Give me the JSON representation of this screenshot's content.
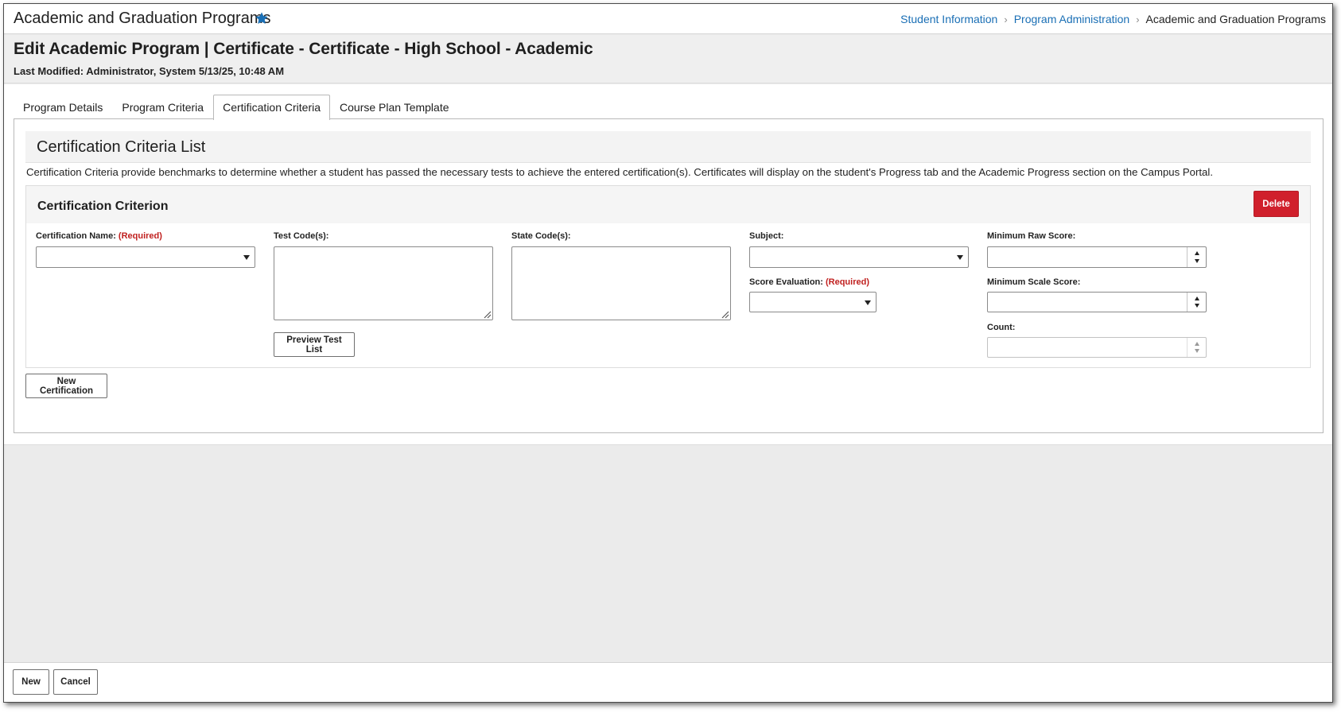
{
  "header": {
    "app_title": "Academic and Graduation Programs",
    "favorite_icon": "star-icon",
    "breadcrumb": {
      "items": [
        "Student Information",
        "Program Administration"
      ],
      "current": "Academic and Graduation Programs"
    }
  },
  "page": {
    "title": "Edit Academic Program | Certificate - Certificate - High School - Academic",
    "last_modified": "Last Modified: Administrator, System 5/13/25, 10:48 AM"
  },
  "tabs": [
    {
      "label": "Program Details",
      "active": false
    },
    {
      "label": "Program Criteria",
      "active": false
    },
    {
      "label": "Certification Criteria",
      "active": true
    },
    {
      "label": "Course Plan Template",
      "active": false
    }
  ],
  "list": {
    "title": "Certification Criteria List",
    "description": "Certification Criteria provide benchmarks to determine whether a student has passed the necessary tests to achieve the entered certification(s). Certificates will display on the student's Progress tab and the Academic Progress section on the Campus Portal."
  },
  "criterion": {
    "title": "Certification Criterion",
    "delete_label": "Delete",
    "required_text": "(Required)",
    "fields": {
      "certification_name": {
        "label": "Certification Name:",
        "value": ""
      },
      "test_codes": {
        "label": "Test Code(s):",
        "value": ""
      },
      "state_codes": {
        "label": "State Code(s):",
        "value": ""
      },
      "subject": {
        "label": "Subject:",
        "value": ""
      },
      "score_evaluation": {
        "label": "Score Evaluation:",
        "value": ""
      },
      "min_raw_score": {
        "label": "Minimum Raw Score:",
        "value": ""
      },
      "min_scale_score": {
        "label": "Minimum Scale Score:",
        "value": ""
      },
      "count": {
        "label": "Count:",
        "value": ""
      }
    },
    "preview_label": "Preview Test List"
  },
  "new_certification_label": "New Certification",
  "footer": {
    "new_label": "New",
    "cancel_label": "Cancel"
  },
  "colors": {
    "link": "#1a6fb5",
    "favorite": "#1a6fb5",
    "delete": "#d0202c",
    "required": "#c0201f"
  }
}
